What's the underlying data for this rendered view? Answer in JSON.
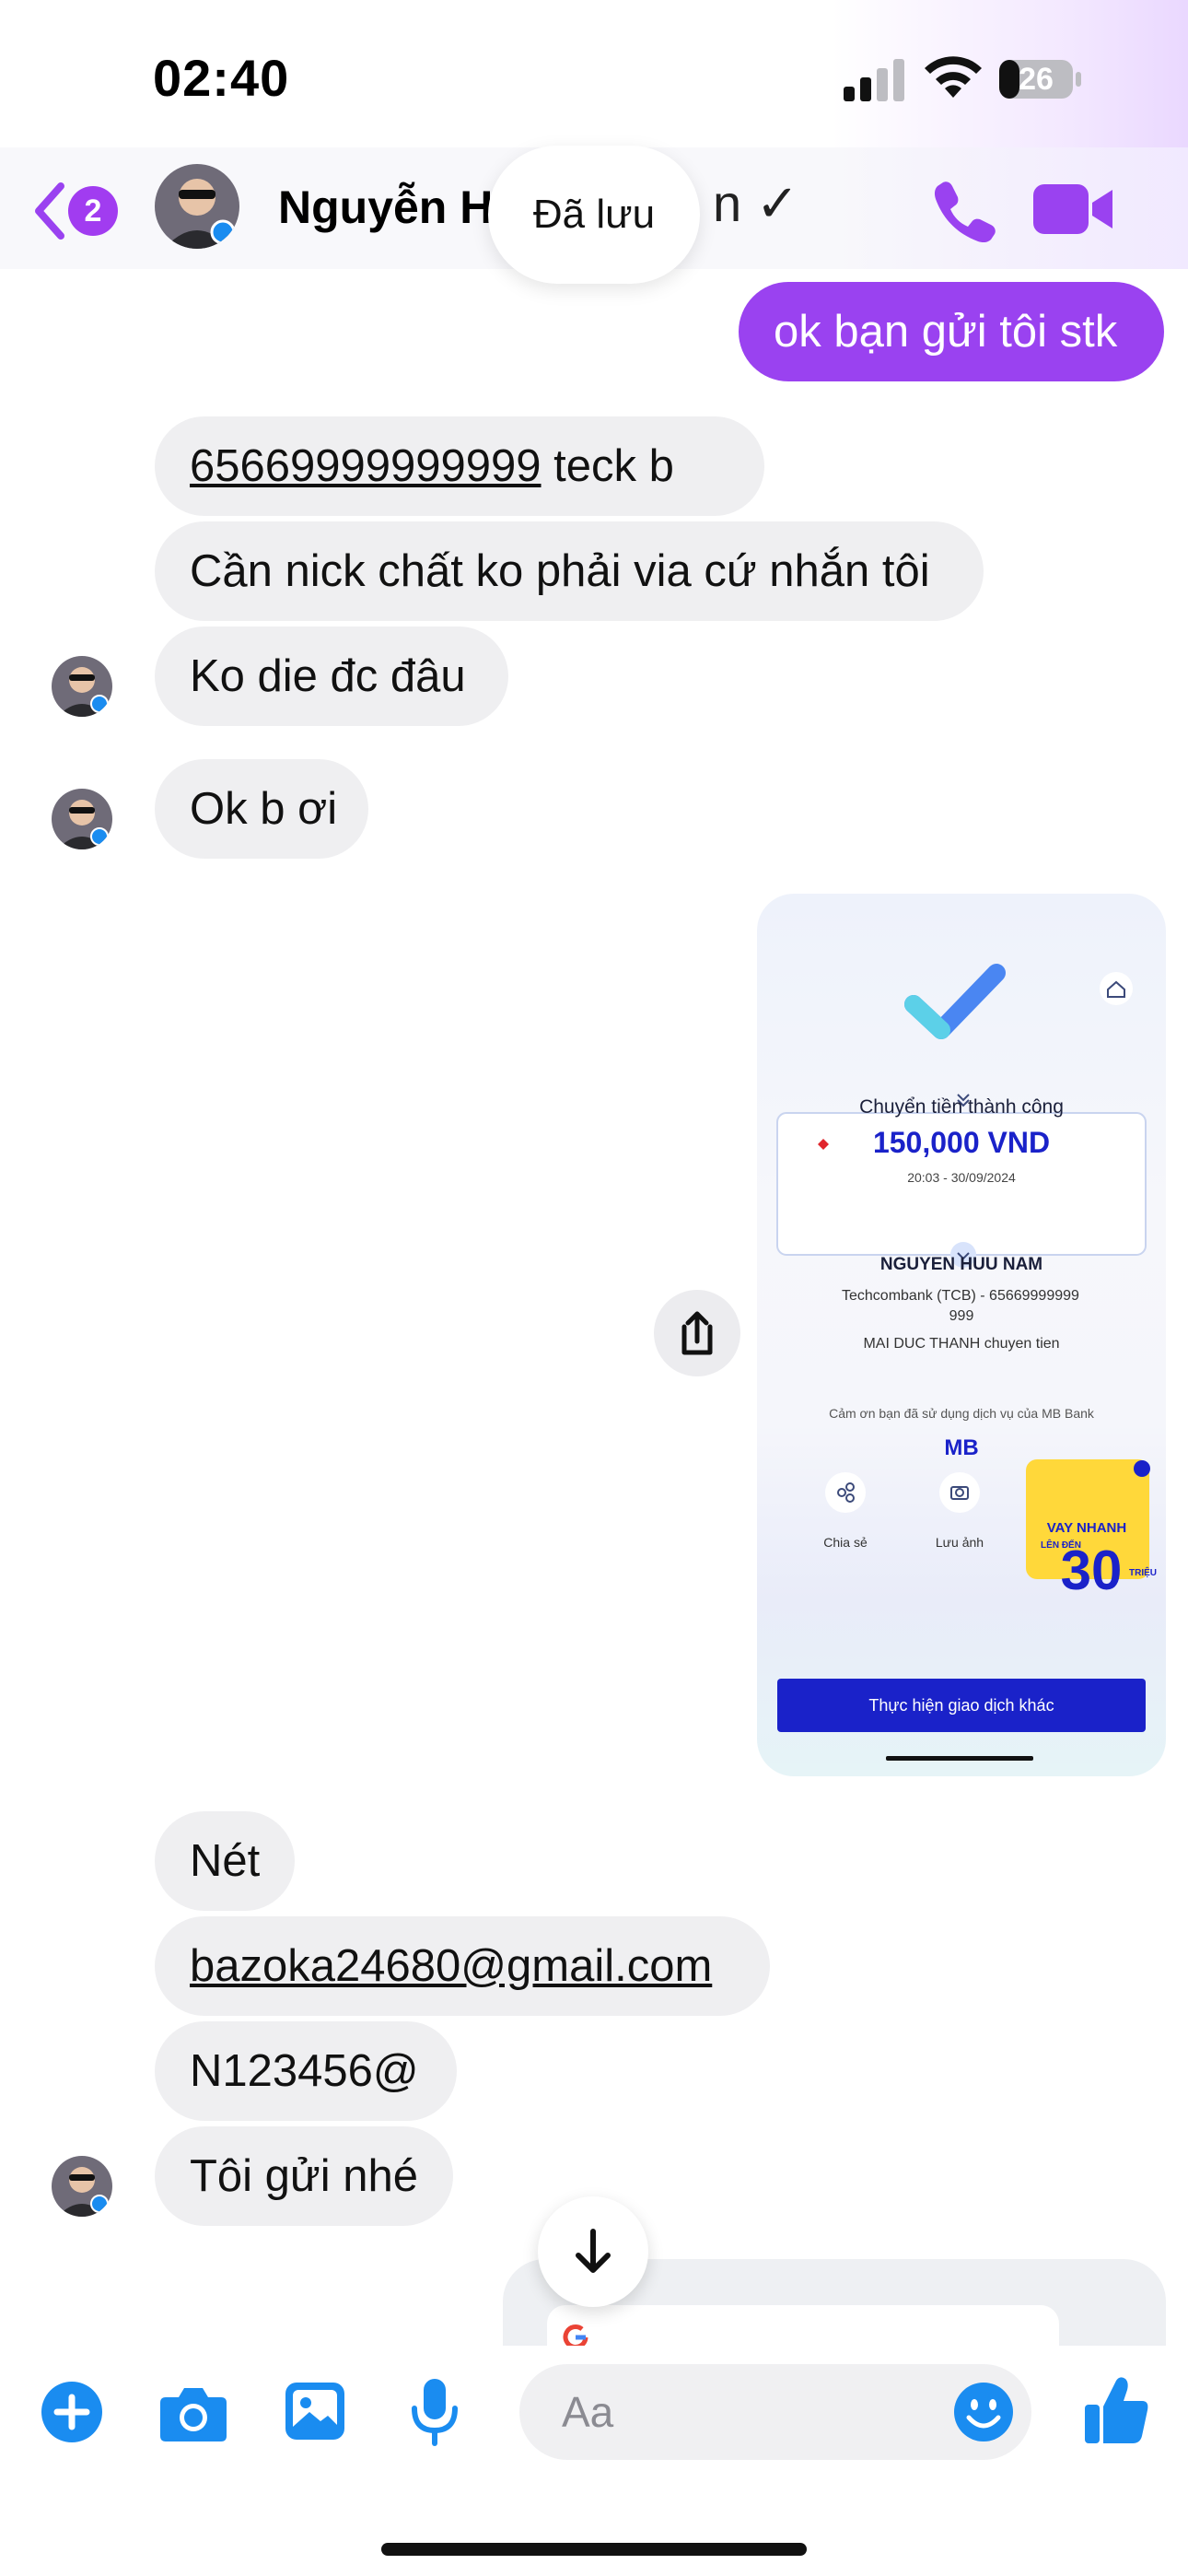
{
  "status_bar": {
    "time": "02:40",
    "battery": "26"
  },
  "header": {
    "back_badge": "2",
    "contact_name": "Nguyễn H",
    "contact_name_tail": "n ✓",
    "saved_toast": "Đã lưu"
  },
  "messages": [
    {
      "side": "out",
      "text": "ok bạn gửi tôi stk"
    },
    {
      "side": "in",
      "link": "65669999999999",
      "text": " teck b"
    },
    {
      "side": "in",
      "text": "Cần nick chất ko phải via cứ nhắn tôi"
    },
    {
      "side": "in",
      "text": "Ko die đc đâu"
    },
    {
      "side": "in",
      "text": "Ok b ơi"
    },
    {
      "side": "in",
      "text": "Nét"
    },
    {
      "side": "in",
      "link": "bazoka24680@gmail.com"
    },
    {
      "side": "in",
      "text": "N123456@"
    },
    {
      "side": "in",
      "text": "Tôi gửi nhé"
    }
  ],
  "receipt": {
    "status": "Chuyển tiền thành công",
    "amount": "150,000 VND",
    "datetime": "20:03 - 30/09/2024",
    "recipient_name": "NGUYEN HUU NAM",
    "bank_line1": "Techcombank (TCB) - 65669999999",
    "bank_line2": "999",
    "note": "MAI DUC THANH chuyen tien",
    "thanks": "Cảm ơn bạn đã sử dụng dịch vụ của MB Bank",
    "bank_logo": "MB",
    "share_label": "Chia sẻ",
    "save_label": "Lưu ảnh",
    "promo_line1": "VAY NHANH",
    "promo_line2": "LÊN ĐẾN",
    "promo_value": "30",
    "promo_unit": "TRIỆU",
    "cta": "Thực hiện giao dịch khác"
  },
  "composer": {
    "placeholder": "Aa"
  },
  "colors": {
    "accent": "#9a42f0",
    "icon_blue": "#1a8cf0",
    "receipt_button": "#1a22c9"
  }
}
